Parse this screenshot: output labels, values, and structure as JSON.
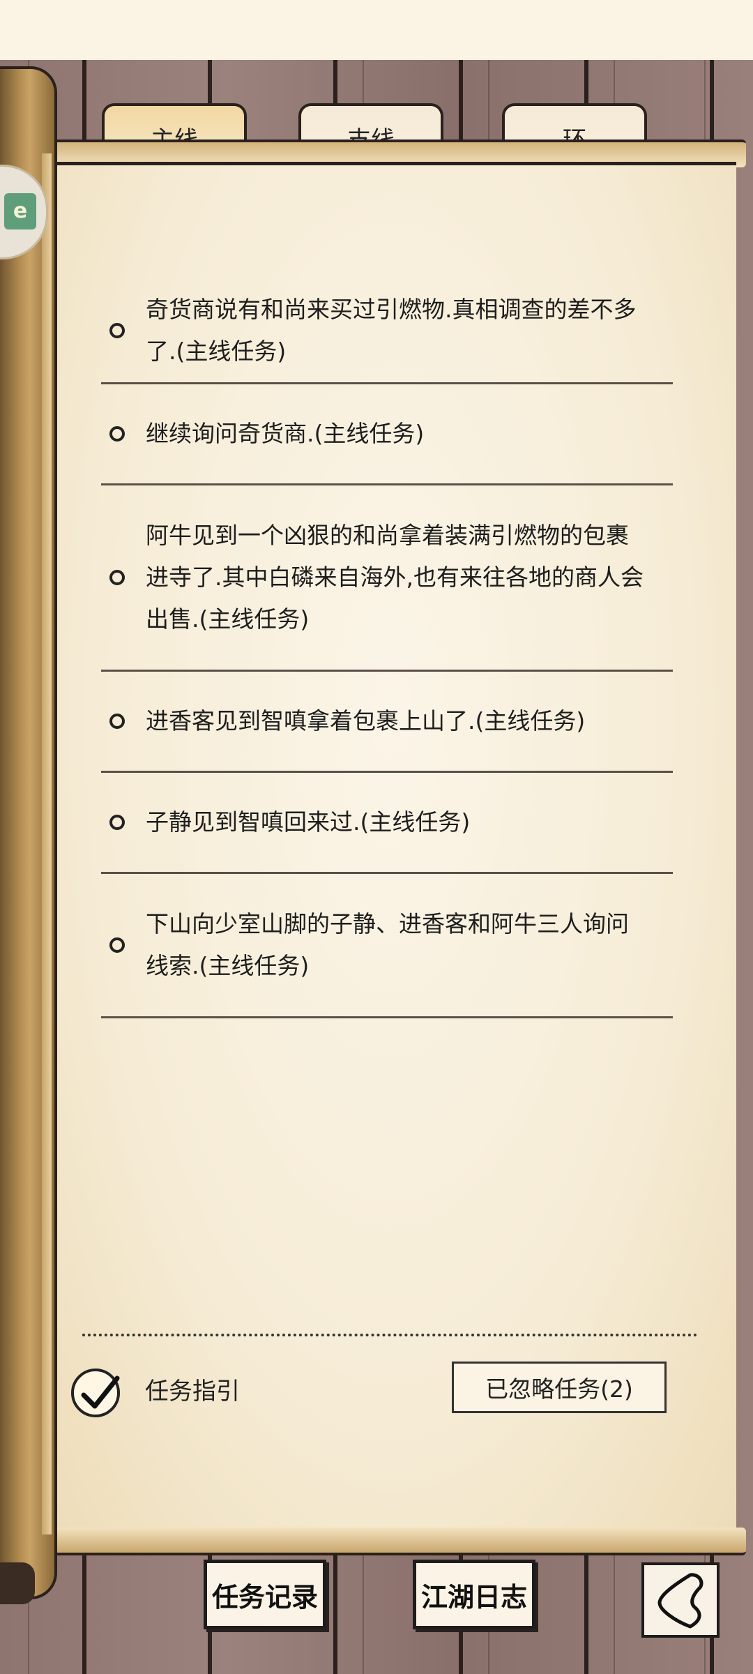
{
  "tabs": [
    {
      "label": "主线",
      "active": true
    },
    {
      "label": "支线",
      "active": false
    },
    {
      "label": "环",
      "active": false
    }
  ],
  "avatar": {
    "badge_text": "e"
  },
  "tasks": [
    {
      "text": "奇货商说有和尚来买过引燃物.真相调查的差不多了.(主线任务)"
    },
    {
      "text": "继续询问奇货商.(主线任务)"
    },
    {
      "text": "阿牛见到一个凶狠的和尚拿着装满引燃物的包裹进寺了.其中白磷来自海外,也有来往各地的商人会出售.(主线任务)"
    },
    {
      "text": "进香客见到智嗔拿着包裹上山了.(主线任务)"
    },
    {
      "text": "子静见到智嗔回来过.(主线任务)"
    },
    {
      "text": "下山向少室山脚的子静、进香客和阿牛三人询问线索.(主线任务)"
    }
  ],
  "guide": {
    "label": "任务指引",
    "checked": true
  },
  "ignored_button": "已忽略任务(2)",
  "bottom": {
    "records": "任务记录",
    "journal": "江湖日志"
  },
  "icons": {
    "back": "back-arrow-icon",
    "check": "checkmark-icon"
  }
}
